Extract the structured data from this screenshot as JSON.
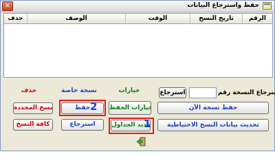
{
  "window": {
    "title": "حفظ واسترجاع البيانات"
  },
  "grid": {
    "columns": [
      "الرقم",
      "تاريخ النسخ",
      "الوقت",
      "الوصف",
      "حذف"
    ]
  },
  "headers": {
    "delete": "حذف",
    "special_copy": "نسخة خاصة",
    "options": "خيارات"
  },
  "buttons": {
    "delete_selected": "النسخ المحددة",
    "delete_all": "كافة النسخ",
    "save": "حفظ",
    "restore": "استرجاع",
    "save_options": "خيارات الحفظ",
    "update_tables": "تحديد الجداول",
    "restore_number": "استرجاع",
    "save_now": "حفظ نسخة الآن",
    "update_backup_data": "تحديث بيانات النسخ الاحتياطية"
  },
  "restore_copy_label": "استرجاع النسخة رقم",
  "restore_copy_value": "",
  "markers": {
    "one": "1",
    "two": "2"
  },
  "colors": {
    "delete": "#d40000",
    "special": "#1c3fbf",
    "options": "#0c7d0c",
    "marker": "#e21b1b",
    "marker_number": "#1a3fd6"
  }
}
